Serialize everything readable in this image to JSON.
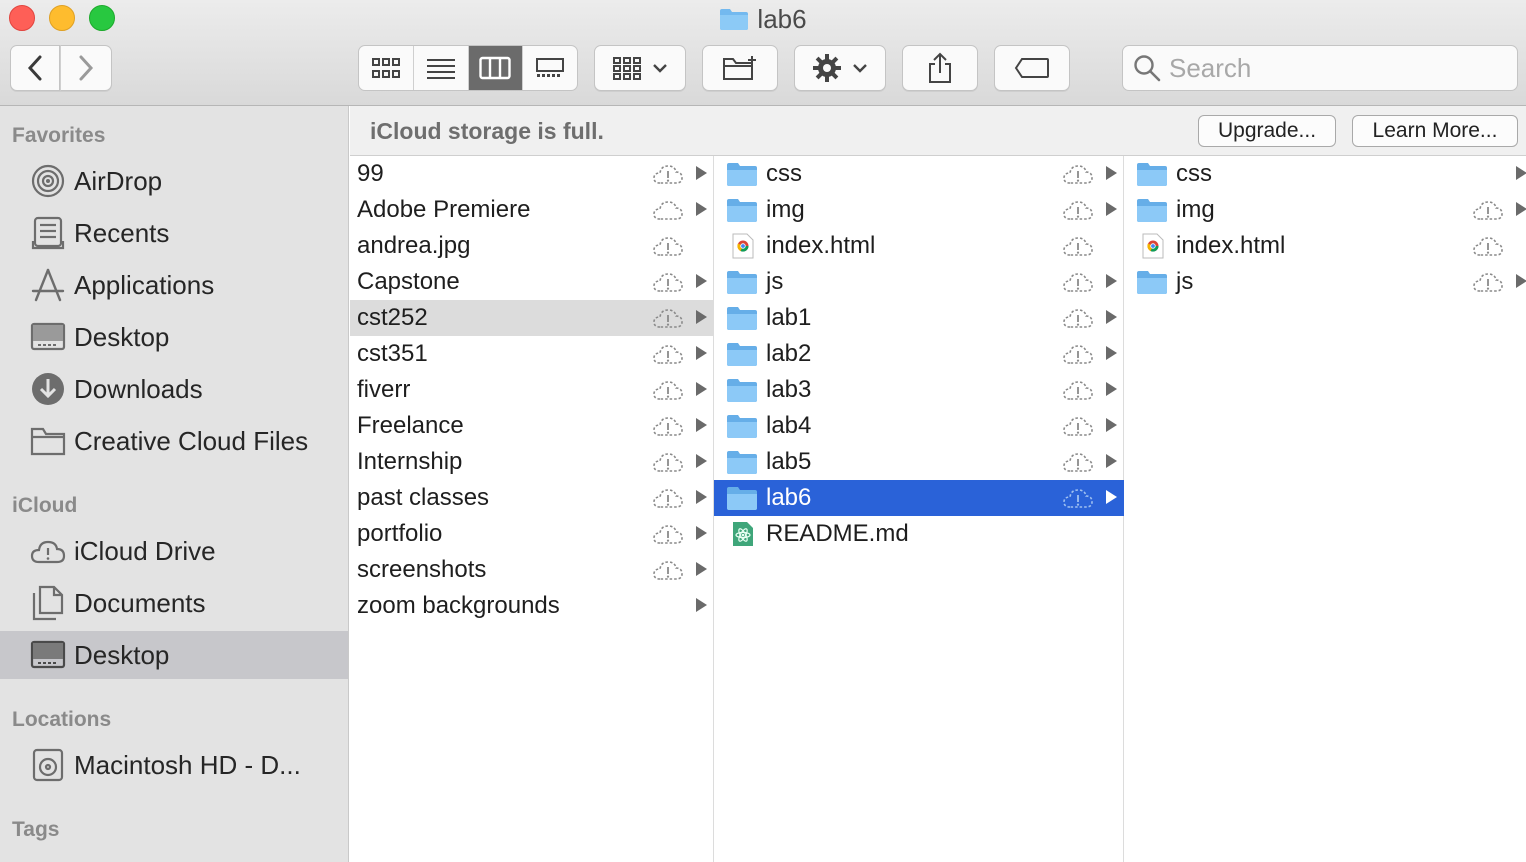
{
  "window": {
    "title": "lab6"
  },
  "toolbar": {
    "back_icon": "chevron-left-icon",
    "forward_icon": "chevron-right-icon",
    "view_modes": [
      "icon-view",
      "list-view",
      "column-view",
      "gallery-view"
    ],
    "active_view": "column-view",
    "search_placeholder": "Search"
  },
  "banner": {
    "message": "iCloud storage is full.",
    "upgrade_label": "Upgrade...",
    "learn_more_label": "Learn More..."
  },
  "sidebar": {
    "favorites_header": "Favorites",
    "favorites": [
      {
        "label": "AirDrop",
        "icon": "airdrop-icon"
      },
      {
        "label": "Recents",
        "icon": "recents-icon"
      },
      {
        "label": "Applications",
        "icon": "applications-icon"
      },
      {
        "label": "Desktop",
        "icon": "desktop-icon"
      },
      {
        "label": "Downloads",
        "icon": "downloads-icon"
      },
      {
        "label": "Creative Cloud Files",
        "icon": "folder-icon"
      }
    ],
    "icloud_header": "iCloud",
    "icloud": [
      {
        "label": "iCloud Drive",
        "icon": "icloud-drive-icon"
      },
      {
        "label": "Documents",
        "icon": "documents-icon"
      },
      {
        "label": "Desktop",
        "icon": "desktop-icon",
        "selected": true
      }
    ],
    "locations_header": "Locations",
    "locations": [
      {
        "label": "Macintosh HD - D...",
        "icon": "hard-drive-icon"
      }
    ],
    "tags_header": "Tags"
  },
  "columns": {
    "col1": [
      {
        "name": "99"
      },
      {
        "name": "Adobe Premiere"
      },
      {
        "name": "andrea.jpg"
      },
      {
        "name": "Capstone"
      },
      {
        "name": "cst252"
      },
      {
        "name": "cst351"
      },
      {
        "name": "fiverr"
      },
      {
        "name": "Freelance"
      },
      {
        "name": "Internship"
      },
      {
        "name": "past classes"
      },
      {
        "name": "portfolio"
      },
      {
        "name": "screenshots"
      },
      {
        "name": "zoom backgrounds"
      }
    ],
    "col2": [
      {
        "name": "css"
      },
      {
        "name": "img"
      },
      {
        "name": "index.html"
      },
      {
        "name": "js"
      },
      {
        "name": "lab1"
      },
      {
        "name": "lab2"
      },
      {
        "name": "lab3"
      },
      {
        "name": "lab4"
      },
      {
        "name": "lab5"
      },
      {
        "name": "lab6"
      },
      {
        "name": "README.md"
      }
    ],
    "col3": [
      {
        "name": "css"
      },
      {
        "name": "img"
      },
      {
        "name": "index.html"
      },
      {
        "name": "js"
      }
    ]
  },
  "colors": {
    "selection_blue": "#2a62d8",
    "folder_blue": "#6fb8f0",
    "sidebar_bg": "#e3e3e3"
  }
}
